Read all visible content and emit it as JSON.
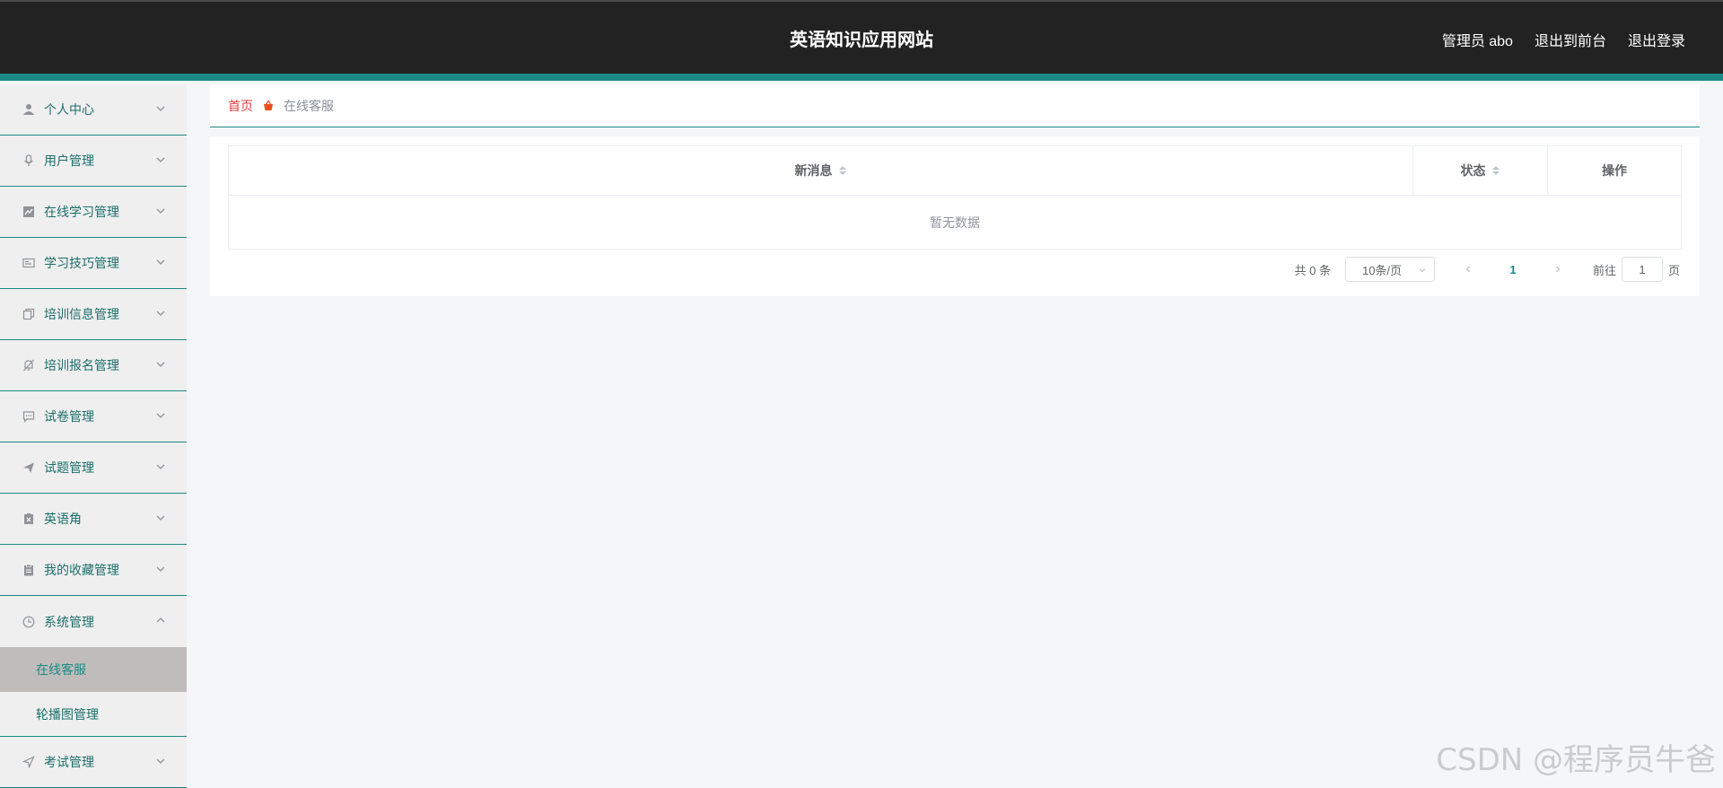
{
  "header": {
    "title": "英语知识应用网站",
    "user_label": "管理员 abo",
    "to_front_label": "退出到前台",
    "logout_label": "退出登录"
  },
  "sidebar": {
    "items": [
      {
        "label": "个人中心",
        "icon": "user-icon"
      },
      {
        "label": "用户管理",
        "icon": "microphone-icon"
      },
      {
        "label": "在线学习管理",
        "icon": "chart-icon"
      },
      {
        "label": "学习技巧管理",
        "icon": "card-icon"
      },
      {
        "label": "培训信息管理",
        "icon": "copy-icon"
      },
      {
        "label": "培训报名管理",
        "icon": "bell-off-icon"
      },
      {
        "label": "试卷管理",
        "icon": "chat-icon"
      },
      {
        "label": "试题管理",
        "icon": "send-icon"
      },
      {
        "label": "英语角",
        "icon": "delete-box-icon"
      },
      {
        "label": "我的收藏管理",
        "icon": "clipboard-icon"
      },
      {
        "label": "系统管理",
        "icon": "clock-icon"
      }
    ],
    "system_subitems": [
      {
        "label": "在线客服"
      },
      {
        "label": "轮播图管理"
      }
    ],
    "last_item": {
      "label": "考试管理",
      "icon": "location-icon"
    }
  },
  "breadcrumb": {
    "home": "首页",
    "current": "在线客服"
  },
  "table": {
    "columns": [
      {
        "label": "新消息",
        "sortable": true
      },
      {
        "label": "状态",
        "sortable": true
      },
      {
        "label": "操作",
        "sortable": false
      }
    ],
    "empty_text": "暂无数据"
  },
  "pagination": {
    "total_label": "共 0 条",
    "page_size": "10条/页",
    "current_page": "1",
    "goto_label": "前往",
    "goto_value": "1",
    "page_suffix": "页"
  },
  "watermark": "CSDN @程序员牛爸",
  "colors": {
    "header_bg": "#222222",
    "accent": "#1b8a86",
    "sidebar_bg": "#efefef",
    "active_bg": "#c0bcbb",
    "home_crumb": "#e64040"
  }
}
